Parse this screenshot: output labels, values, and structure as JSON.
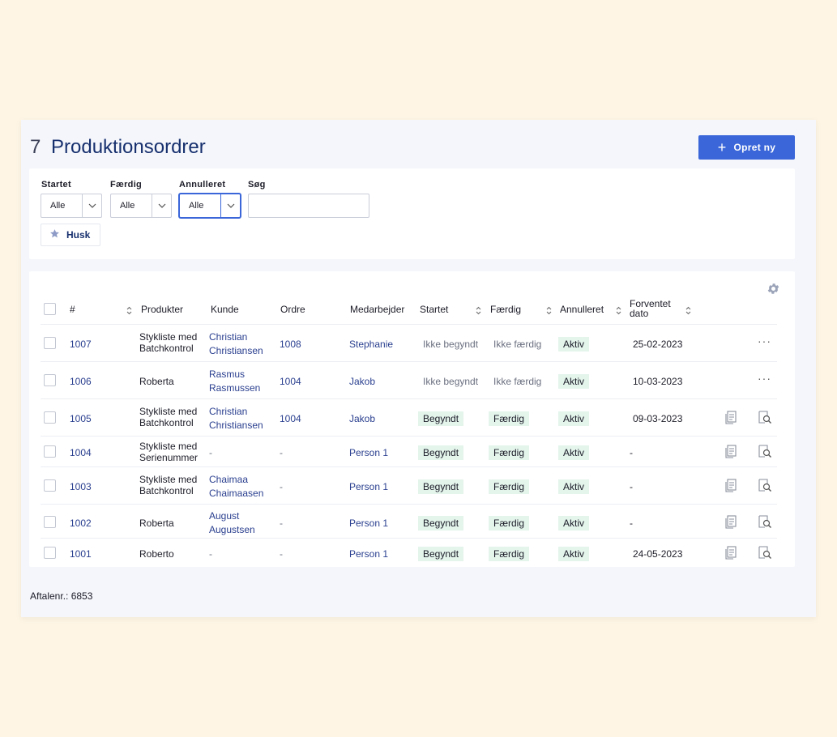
{
  "header": {
    "count": "7",
    "title": "Produktionsordrer",
    "create_label": "Opret ny"
  },
  "filters": {
    "started_label": "Startet",
    "started_value": "Alle",
    "finished_label": "Færdig",
    "finished_value": "Alle",
    "cancelled_label": "Annulleret",
    "cancelled_value": "Alle",
    "search_label": "Søg",
    "search_value": "",
    "remember_label": "Husk"
  },
  "table": {
    "columns": {
      "number": "#",
      "products": "Produkter",
      "customer": "Kunde",
      "order": "Ordre",
      "employee": "Medarbejder",
      "started": "Startet",
      "finished": "Færdig",
      "cancelled": "Annulleret",
      "expected": "Forventet dato"
    },
    "rows": [
      {
        "number": "1007",
        "product": "Stykliste med Batchkontrol",
        "customer": "Christian Christiansen",
        "order": "1008",
        "employee": "Stephanie",
        "started": "Ikke begyndt",
        "finished": "Ikke færdig",
        "cancelled": "Aktiv",
        "expected": "25-02-2023",
        "actions": "more"
      },
      {
        "number": "1006",
        "product": "Roberta",
        "customer": "Rasmus Rasmussen",
        "order": "1004",
        "employee": "Jakob",
        "started": "Ikke begyndt",
        "finished": "Ikke færdig",
        "cancelled": "Aktiv",
        "expected": "10-03-2023",
        "actions": "more"
      },
      {
        "number": "1005",
        "product": "Stykliste med Batchkontrol",
        "customer": "Christian Christiansen",
        "order": "1004",
        "employee": "Jakob",
        "started": "Begyndt",
        "finished": "Færdig",
        "cancelled": "Aktiv",
        "expected": "09-03-2023",
        "actions": "icons"
      },
      {
        "number": "1004",
        "product": "Stykliste med Serienummer",
        "customer": "-",
        "order": "-",
        "employee": "Person 1",
        "started": "Begyndt",
        "finished": "Færdig",
        "cancelled": "Aktiv",
        "expected": "-",
        "actions": "icons"
      },
      {
        "number": "1003",
        "product": "Stykliste med Batchkontrol",
        "customer": "Chaimaa Chaimaasen",
        "order": "-",
        "employee": "Person 1",
        "started": "Begyndt",
        "finished": "Færdig",
        "cancelled": "Aktiv",
        "expected": "-",
        "actions": "icons"
      },
      {
        "number": "1002",
        "product": "Roberta",
        "customer": "August Augustsen",
        "order": "-",
        "employee": "Person 1",
        "started": "Begyndt",
        "finished": "Færdig",
        "cancelled": "Aktiv",
        "expected": "-",
        "actions": "icons"
      },
      {
        "number": "1001",
        "product": "Roberto",
        "customer": "-",
        "order": "-",
        "employee": "Person 1",
        "started": "Begyndt",
        "finished": "Færdig",
        "cancelled": "Aktiv",
        "expected": "24-05-2023",
        "actions": "icons"
      }
    ]
  },
  "footer": {
    "agreement": "Aftalenr.: 6853"
  },
  "colors": {
    "accent": "#3a66d9",
    "title": "#17306e",
    "badge_bg": "#e4f5ec",
    "background": "#fef5e5"
  },
  "icons": [
    "plus-icon",
    "chevron-down-icon",
    "star-icon",
    "gear-icon",
    "sort-icon",
    "more-icon",
    "document-icon",
    "search-document-icon"
  ]
}
